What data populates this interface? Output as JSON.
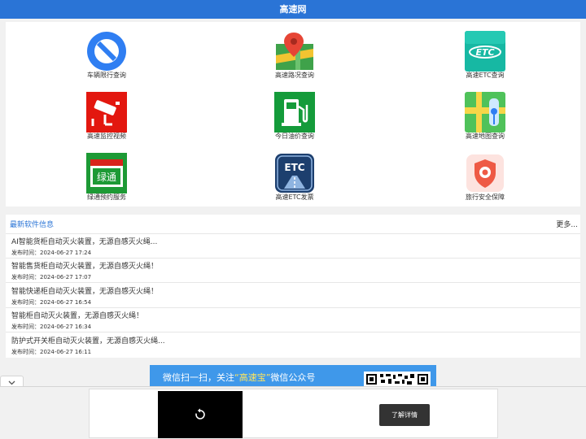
{
  "header": {
    "title": "高速网"
  },
  "tiles": [
    {
      "label": "车辆限行查询",
      "icon": "no-entry-icon"
    },
    {
      "label": "高速路况查询",
      "icon": "map-pin-icon"
    },
    {
      "label": "高速ETC查询",
      "icon": "etc-card-icon"
    },
    {
      "label": "高速监控视频",
      "icon": "cctv-camera-icon"
    },
    {
      "label": "今日油价查询",
      "icon": "fuel-pump-icon"
    },
    {
      "label": "高速地图查询",
      "icon": "road-map-icon"
    },
    {
      "label": "绿通预约服务",
      "icon": "green-pass-calendar-icon"
    },
    {
      "label": "高速ETC发票",
      "icon": "etc-invoice-icon"
    },
    {
      "label": "旅行安全保障",
      "icon": "safety-shield-icon"
    }
  ],
  "green_pass_icon_text": "绿通",
  "etc_icon_text": "ETC",
  "news": {
    "title": "最新软件信息",
    "more_label": "更多...",
    "items": [
      {
        "title": "AI智能货柜自动灭火装置，无源自感灭火绳...",
        "date": "发布时间：2024-06-27 17:24"
      },
      {
        "title": "智能售货柜自动灭火装置，无源自感灭火绳！",
        "date": "发布时间：2024-06-27 17:07"
      },
      {
        "title": "智能快递柜自动灭火装置，无源自感灭火绳！",
        "date": "发布时间：2024-06-27 16:54"
      },
      {
        "title": "智能柜自动灭火装置，无源自感灭火绳！",
        "date": "发布时间：2024-06-27 16:34"
      },
      {
        "title": "防护式开关柜自动灭火装置，无源自感灭火绳...",
        "date": "发布时间：2024-06-27 16:11"
      }
    ]
  },
  "promo": {
    "text_before": "微信扫一扫，关注",
    "highlight": "“高速宝”",
    "text_after": "微信公众号"
  },
  "ad": {
    "cta_label": "了解详情"
  },
  "colors": {
    "header_bg": "#2a74d6",
    "accent": "#2a74d6",
    "promo_bg": "#3f98ea",
    "promo_highlight": "#ffe45c"
  }
}
